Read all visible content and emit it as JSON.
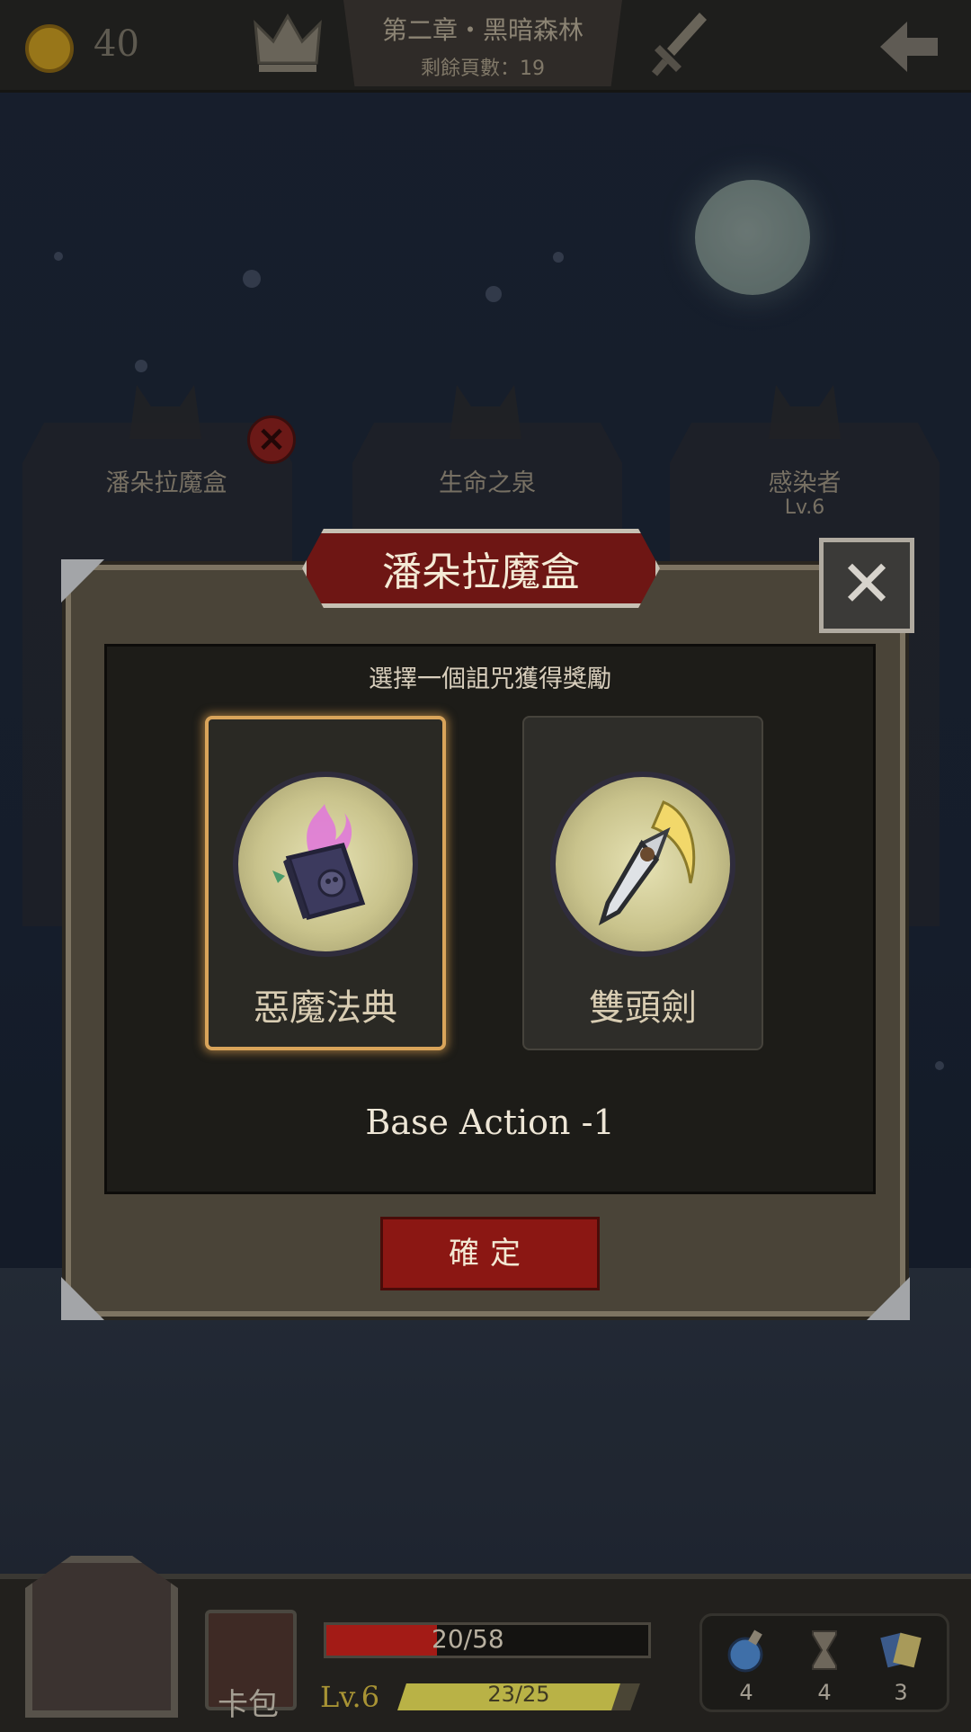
{
  "top_bar": {
    "coin_count": "40",
    "chapter_title": "第二章・黑暗森林",
    "pages_remaining": "剩餘頁數：19"
  },
  "encounters": [
    {
      "name": "潘朵拉魔盒"
    },
    {
      "name": "生命之泉"
    },
    {
      "name": "感染者",
      "level": "Lv.6"
    }
  ],
  "modal": {
    "title": "潘朵拉魔盒",
    "subtitle": "選擇一個詛咒獲得獎勵",
    "choices": [
      {
        "label": "惡魔法典",
        "icon": "demon-tome-icon",
        "selected": true
      },
      {
        "label": "雙頭劍",
        "icon": "double-blade-icon",
        "selected": false
      }
    ],
    "effect": "Base Action -1",
    "confirm_label": "確定"
  },
  "hud": {
    "deck_label": "卡包",
    "hp_text": "20/58",
    "hp_current": 20,
    "hp_max": 58,
    "level": "Lv.6",
    "xp_text": "23/25",
    "xp_current": 23,
    "xp_max": 25,
    "items": [
      {
        "icon": "potion-icon",
        "count": "4"
      },
      {
        "icon": "hourglass-icon",
        "count": "4"
      },
      {
        "icon": "cards-icon",
        "count": "3"
      }
    ]
  },
  "colors": {
    "accent_red": "#8b1713",
    "selection_gold": "#d9a45a",
    "hp_red": "#a31b16",
    "xp_yellow": "#b9b246"
  }
}
